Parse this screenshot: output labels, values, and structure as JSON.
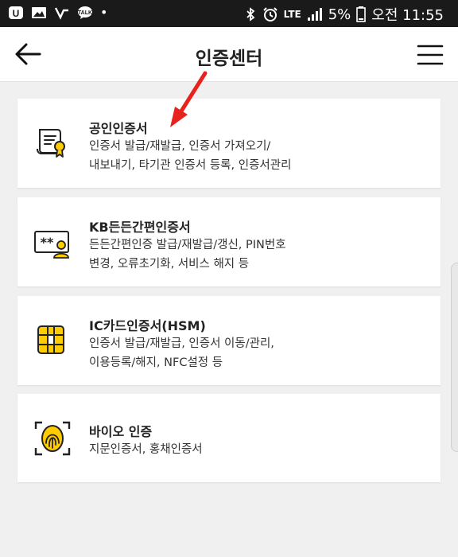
{
  "status_bar": {
    "battery": "5%",
    "time_label": "오전 11:55",
    "network": "LTE",
    "notification_icons": [
      "u-plus-icon",
      "image-icon",
      "wifi-calling-icon",
      "talk-icon"
    ]
  },
  "header": {
    "title": "인증센터",
    "back_icon": "arrow-left-icon",
    "menu_icon": "hamburger-icon"
  },
  "colors": {
    "accent": "#ffcc00",
    "icon_stroke": "#222222",
    "annotation_arrow": "#e8231d"
  },
  "cards": [
    {
      "title": "공인인증서",
      "desc_lines": [
        "인증서 발급/재발급, 인증서 가져오기/",
        "내보내기, 타기관 인증서 등록, 인증서관리"
      ],
      "icon": "certificate-icon"
    },
    {
      "title": "KB든든간편인증서",
      "desc_lines": [
        "든든간편인증 발급/재발급/갱신, PIN번호",
        "변경, 오류초기화, 서비스 해지 등"
      ],
      "icon": "pin-user-icon"
    },
    {
      "title": "IC카드인증서(HSM)",
      "desc_lines": [
        "인증서 발급/재발급, 인증서 이동/관리,",
        "이용등록/해지, NFC설정 등"
      ],
      "icon": "ic-chip-icon"
    },
    {
      "title": "바이오 인증",
      "desc_lines": [
        "지문인증서, 홍채인증서"
      ],
      "icon": "fingerprint-icon"
    }
  ]
}
